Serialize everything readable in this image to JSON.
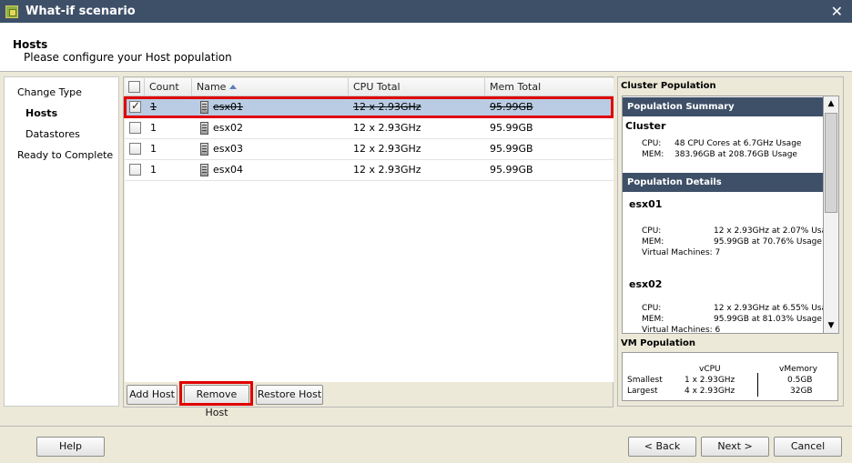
{
  "window": {
    "title": "What-if scenario",
    "close": "✕"
  },
  "header": {
    "title": "Hosts",
    "subtitle": "Please configure your Host population"
  },
  "steps": [
    "Change Type",
    "Hosts",
    "Datastores",
    "Ready to Complete"
  ],
  "grid": {
    "columns": [
      "Count",
      "Name",
      "CPU Total",
      "Mem Total"
    ],
    "rows": [
      {
        "checked": true,
        "count": "1",
        "name": "esx01",
        "cpu": "12 x 2.93GHz",
        "mem": "95.99GB",
        "selected": true,
        "removed": true
      },
      {
        "checked": false,
        "count": "1",
        "name": "esx02",
        "cpu": "12 x 2.93GHz",
        "mem": "95.99GB"
      },
      {
        "checked": false,
        "count": "1",
        "name": "esx03",
        "cpu": "12 x 2.93GHz",
        "mem": "95.99GB"
      },
      {
        "checked": false,
        "count": "1",
        "name": "esx04",
        "cpu": "12 x 2.93GHz",
        "mem": "95.99GB"
      }
    ]
  },
  "buttons": {
    "add_host": "Add Host",
    "remove_host": "Remove Host",
    "restore_host": "Restore Host"
  },
  "cluster": {
    "section_title": "Cluster Population",
    "summary_header": "Population Summary",
    "cluster_label": "Cluster",
    "cpu_label": "CPU:",
    "cpu_value": "48 CPU Cores at  6.7GHz Usage",
    "mem_label": "MEM:",
    "mem_value": "383.96GB at 208.76GB Usage",
    "details_header": "Population Details",
    "hosts": [
      {
        "name": "esx01",
        "cpu_label": "CPU:",
        "cpu": "12 x 2.93GHz at  2.07% Usa",
        "mem_label": "MEM:",
        "mem": "95.99GB at  70.76% Usage",
        "vms": "Virtual Machines: 7"
      },
      {
        "name": "esx02",
        "cpu_label": "CPU:",
        "cpu": "12 x 2.93GHz at  6.55% Usa",
        "mem_label": "MEM:",
        "mem": "95.99GB at  81.03% Usage",
        "vms": "Virtual Machines: 6"
      }
    ]
  },
  "vm_population": {
    "title": "VM Population",
    "col_vcpu": "vCPU",
    "col_vmem": "vMemory",
    "rows": [
      {
        "label": "Smallest",
        "vcpu": "1 x 2.93GHz",
        "vmem": "0.5GB"
      },
      {
        "label": "Largest",
        "vcpu": "4 x 2.93GHz",
        "vmem": "32GB"
      }
    ]
  },
  "footer": {
    "help": "Help",
    "back": "< Back",
    "next": "Next >",
    "cancel": "Cancel"
  },
  "colors": {
    "titlebar": "#3e5068",
    "selection": "#b9cce3",
    "highlight": "#e00000"
  }
}
